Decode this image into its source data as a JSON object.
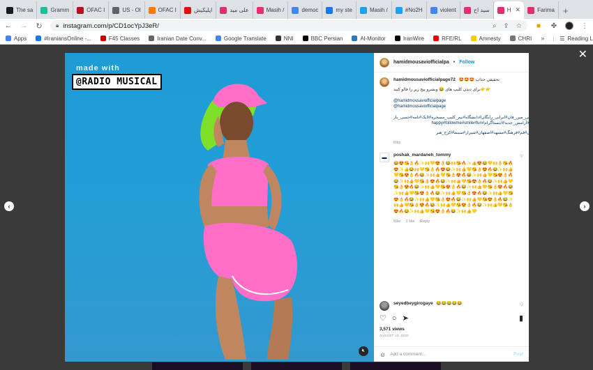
{
  "browser": {
    "tabs": [
      {
        "label": "The sa",
        "color": "#1a1a1a"
      },
      {
        "label": "Gramm",
        "color": "#15c39a"
      },
      {
        "label": "OFAC I",
        "color": "#b5121b"
      },
      {
        "label": "US - Ol",
        "color": "#5f6368"
      },
      {
        "label": "OFAC I",
        "color": "#ff7a00"
      },
      {
        "label": "اپلیکیش",
        "color": "#d11"
      },
      {
        "label": "علی مید",
        "color": "#e1306c"
      },
      {
        "label": "Masih /",
        "color": "#e1306c"
      },
      {
        "label": "democ",
        "color": "#4285f4"
      },
      {
        "label": "my ste",
        "color": "#1877f2"
      },
      {
        "label": "Masih /",
        "color": "#1da1f2"
      },
      {
        "label": "#No2H",
        "color": "#1da1f2"
      },
      {
        "label": "violent",
        "color": "#4285f4"
      },
      {
        "label": "سید اح",
        "color": "#e1306c"
      },
      {
        "label": "H",
        "color": "#e1306c",
        "active": true
      },
      {
        "label": "Farima",
        "color": "#e1306c"
      }
    ],
    "tab_close": "✕",
    "new_tab": "+",
    "url": "instagram.com/p/CD1ocYpJ3eR/",
    "bookmarks": [
      {
        "label": "Apps",
        "color": "#4285f4"
      },
      {
        "label": "#IraniansOnline -...",
        "color": "#1877f2"
      },
      {
        "label": "F45 Classes",
        "color": "#c00"
      },
      {
        "label": "Iranian Date Conv...",
        "color": "#666"
      },
      {
        "label": "Google Translate",
        "color": "#4285f4"
      },
      {
        "label": "NNI",
        "color": "#333"
      },
      {
        "label": "BBC Persian",
        "color": "#000"
      },
      {
        "label": "Al-Monitor",
        "color": "#2a7ab8"
      },
      {
        "label": "IranWire",
        "color": "#000"
      },
      {
        "label": "RFE/RL",
        "color": "#e00"
      },
      {
        "label": "Amnesty",
        "color": "#ffcc00"
      },
      {
        "label": "CHRI",
        "color": "#777"
      }
    ],
    "bookmarks_more": "»",
    "reading_list": "Reading List"
  },
  "media": {
    "watermark_top": "made with",
    "watermark_box": "@RADIO MUSICAL"
  },
  "post": {
    "author": "hamidmousaviofficialpa",
    "follow": "Follow",
    "caption_user": "hamidmousaviofficialpage72",
    "caption_line1": "🤩🤩🤩 تحقیقی جذاب",
    "caption_line2": "👉👉برای دیدن کلیپ های 😂 وبشرو پیج زیر را فالو کنید",
    "mentions": [
      "@hamidmousaviofficialpage",
      "@hamidmousaviofficialpage"
    ],
    "tags_line1": "#کرشی_مین_فان#ایرانی_رایگان#دانشگاه#نیم_کلیپ_مسخره#لایک#نامه#حسی_باز",
    "tags_line2": "#لایک#آرامش_جدید#اینستاگرام#happy#followme#smile#fun",
    "tags_line3": "#تهران#قم#فرهنگ#مشهد#اصفهان#شیراز#سینما#کرج_هنر",
    "caption_time": "69w",
    "comment1_user": "poshak_mardaneh_tommy",
    "comment1_text": "😂😍😘👌🔥✨🙌💛😍👌😂🙌😘🔥✨👍😍😂💛🙌👌😘🔥😍✨👍😂🙌💛😘👌🔥😍😂✨🙌👍💛😘👌😍🔥😂✨🙌👍💛😘😍👌🔥😂✨🙌👍💛😘👌😍🔥😂✨🙌👍💛😘😍👌🔥😂✨🙌👍💛😘👌😍🔥😂✨🙌👍💛😘😍👌🔥😂✨🙌👍💛😘👌😍🔥😂✨🙌👍💛😘😍👌🔥😂✨🙌👍💛😘👌😍🔥😂✨🙌👍💛😘😍👌🔥😂✨🙌👍💛😘👌😍🔥😂✨🙌👍💛😘😍👌🔥😂✨🙌👍💛😘👌😍🔥😂✨🙌👍💛😘😍👌🔥😂✨🙌👍💛😘👌😍🔥😂✨🙌👍💛😘😍👌🔥😂✨🙌👍💛😘👌😍🔥😂✨🙌👍💛😘😍👌🔥😂✨🙌👍💛",
    "comment1_time": "69w",
    "comment1_likes": "1 like",
    "comment1_reply": "Reply",
    "comment2_user": "seyedbeygirogaye",
    "comment2_text": "😂😂😂😂😂",
    "views": "3,571 views",
    "date": "AUGUST 13, 2020",
    "comment_placeholder": "Add a comment...",
    "post_button": "Post"
  }
}
